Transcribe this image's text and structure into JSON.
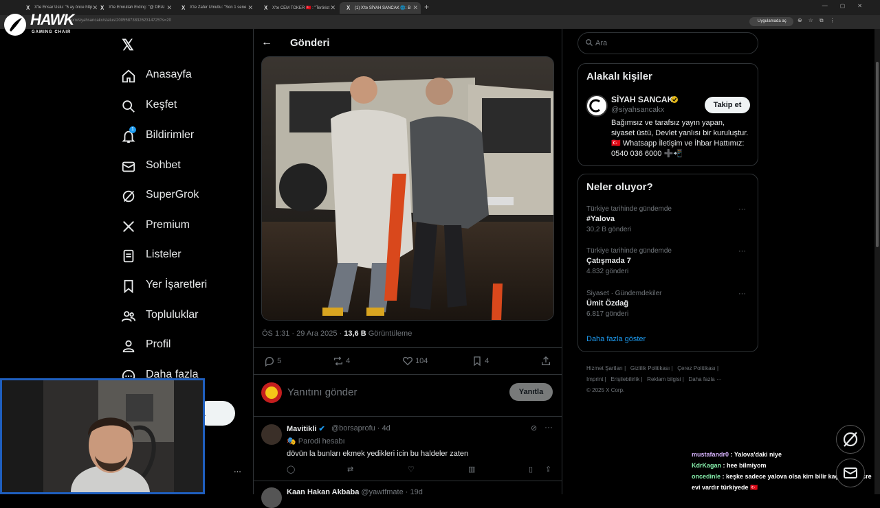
{
  "browser": {
    "tabs": [
      {
        "title": "X'te Ensar Uslu: \"5 ay önce http"
      },
      {
        "title": "X'te Emrullah Erdinç: \"@ DEAI"
      },
      {
        "title": "X'te Zafer Umutlu: \"Son 1 sene"
      },
      {
        "title": "X'te CEM TOKER 🇹🇷 : \"Terörist"
      },
      {
        "title": "(1) X'te SİYAH SANCAK 🌐: B",
        "active": true
      }
    ],
    "new_tab": "+",
    "url": "x.com/siyahsancakx/status/2005587383262314725?s=20",
    "app_pill": "Uygulamada aç"
  },
  "overlay": {
    "hawk_title": "HAWK",
    "hawk_sub": "GAMING CHAIR"
  },
  "nav": {
    "items": [
      {
        "label": "Anasayfa",
        "icon": "home-icon"
      },
      {
        "label": "Keşfet",
        "icon": "search-icon"
      },
      {
        "label": "Bildirimler",
        "icon": "bell-icon",
        "badge": "1"
      },
      {
        "label": "Sohbet",
        "icon": "mail-icon"
      },
      {
        "label": "SuperGrok",
        "icon": "grok-icon"
      },
      {
        "label": "Premium",
        "icon": "x-icon"
      },
      {
        "label": "Listeler",
        "icon": "list-icon"
      },
      {
        "label": "Yer İşaretleri",
        "icon": "bookmark-icon"
      },
      {
        "label": "Topluluklar",
        "icon": "people-icon"
      },
      {
        "label": "Profil",
        "icon": "person-icon"
      },
      {
        "label": "Daha fazla",
        "icon": "more-circle-icon"
      }
    ],
    "post_button_partial": "a",
    "more": "..."
  },
  "header": {
    "title": "Gönderi"
  },
  "post": {
    "time": "ÖS 1:31 · 29 Ara 2025 · ",
    "views": "13,6 B",
    "views_label": " Görüntüleme",
    "stats": {
      "replies": "5",
      "reposts": "4",
      "likes": "104",
      "bookmarks": "4"
    }
  },
  "reply": {
    "placeholder": "Yanıtını gönder",
    "button": "Yanıtla"
  },
  "comments": [
    {
      "name": "Mavitikli",
      "handle": "@borsaprofu · 4d",
      "parody": "Parodi hesabı",
      "text": "dövün la bunları ekmek yedikleri icin bu haldeler zaten"
    },
    {
      "name": "Kaan Hakan Akbaba",
      "handle": "@yawtfmate · 19d"
    }
  ],
  "search": {
    "placeholder": "Ara"
  },
  "related": {
    "title": "Alakalı kişiler",
    "name": "SİYAH SANCAK",
    "handle": "@siyahsancakx",
    "follow": "Takip et",
    "bio": "Bağımsız ve tarafsız yayın yapan, siyaset üstü, Devlet yanlısı bir kuruluştur. 🇹🇷 Whatsapp İletişim ve İhbar Hattımız: 0540 036 6000 ➕📲"
  },
  "trends": {
    "title": "Neler oluyor?",
    "items": [
      {
        "context": "Türkiye tarihinde gündemde",
        "name": "#Yalova",
        "count": "30,2 B gönderi"
      },
      {
        "context": "Türkiye tarihinde gündemde",
        "name": "Çatışmada 7",
        "count": "4.832 gönderi"
      },
      {
        "context": "Siyaset · Gündemdekiler",
        "name": "Ümit Özdağ",
        "count": "6.817 gönderi"
      }
    ],
    "show_more": "Daha fazla göster"
  },
  "footer": {
    "links": [
      "Hizmet Şartları",
      "Gizlilik Politikası",
      "Çerez Politikası",
      "Imprint",
      "Erişilebilirlik",
      "Reklam bilgisi",
      "Daha fazla ···"
    ],
    "copyright": "© 2025 X Corp."
  },
  "chat": [
    {
      "user": "mustafandr0",
      "message": " : Yalova'daki niye",
      "color": "#d8b4fe"
    },
    {
      "user": "KdrKagan",
      "message": " : hee bilmiyom",
      "color": "#86efac"
    },
    {
      "user": "oncedinle",
      "message": " : keşke sadece yalova olsa kim bilir kaç tane hücre evi vardır türkiyede 🇹🇷",
      "color": "#86efac"
    }
  ],
  "colors": {
    "accent": "#1d9bf0",
    "background": "#000000",
    "border": "#2f3336",
    "muted": "#71767b"
  }
}
